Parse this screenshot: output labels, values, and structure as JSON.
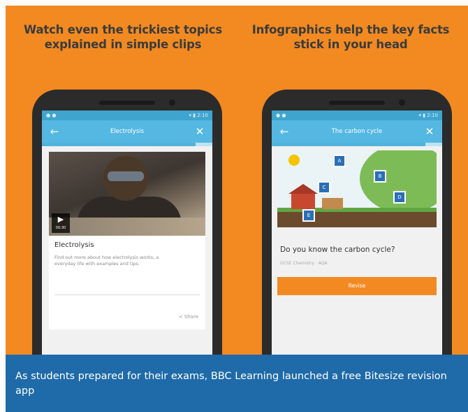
{
  "promo": {
    "background_color": "#f28a21",
    "headlines": {
      "left": "Watch even the trickiest topics explained in simple clips",
      "right": "Infographics help the key facts stick in your head"
    }
  },
  "phone_left": {
    "status_left": "● ●",
    "status_right": "▾ ▮ 2:10",
    "app_bar": {
      "back_icon": "←",
      "title": "Electrolysis",
      "close_icon": "✕"
    },
    "progress": 0.9,
    "video": {
      "play_icon": "▶",
      "duration": "00:30"
    },
    "card": {
      "title": "Electrolysis",
      "description": "Find out more about how electrolysis works, a everyday life with examples and tips.",
      "share_label": "Share"
    }
  },
  "phone_right": {
    "status_left": "● ●",
    "status_right": "▾ ▮ 2:10",
    "app_bar": {
      "back_icon": "←",
      "title": "The carbon cycle",
      "close_icon": "✕"
    },
    "progress": 0.9,
    "infographic_tags": [
      "A",
      "B",
      "C",
      "D",
      "E"
    ],
    "question": "Do you know the carbon cycle?",
    "question_sub": "GCSE Chemistry · AQA",
    "button_label": "Revise"
  },
  "caption": {
    "text": "As students prepared for their exams, BBC Learning launched a free Bitesize revision app",
    "background_color": "#1f6aa8"
  }
}
